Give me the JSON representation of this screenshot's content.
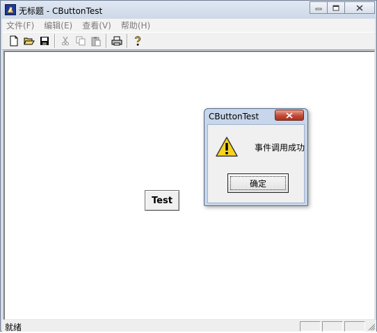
{
  "window": {
    "title": "无标题 - CButtonTest",
    "icons": {
      "app": "app-icon",
      "minimize": "minimize-icon",
      "maximize": "maximize-icon",
      "close": "close-icon"
    }
  },
  "menu": {
    "items": [
      {
        "label": "文件(F)"
      },
      {
        "label": "编辑(E)"
      },
      {
        "label": "查看(V)"
      },
      {
        "label": "帮助(H)"
      }
    ]
  },
  "toolbar": {
    "buttons": [
      "new-file-icon",
      "open-folder-icon",
      "save-icon",
      "cut-icon",
      "copy-icon",
      "paste-icon",
      "print-icon",
      "help-icon"
    ]
  },
  "main": {
    "test_button_label": "Test"
  },
  "statusbar": {
    "text": "就绪"
  },
  "dialog": {
    "title": "CButtonTest",
    "message": "事件调用成功",
    "ok_label": "确定",
    "icon": "warning-icon"
  },
  "colors": {
    "titlebar": "#cdd8e7",
    "dialog_frame": "#c7d6ea",
    "close_button": "#c24a36"
  }
}
